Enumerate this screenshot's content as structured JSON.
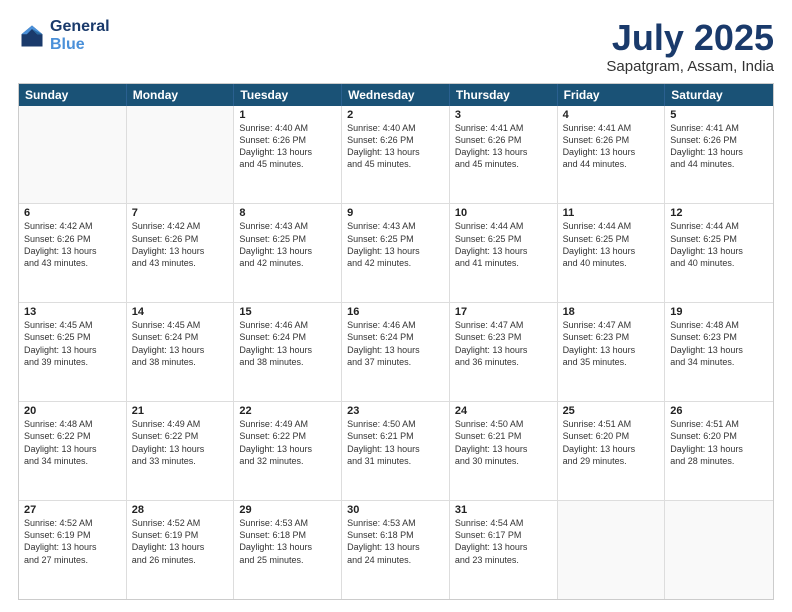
{
  "logo": {
    "line1": "General",
    "line2": "Blue"
  },
  "title": "July 2025",
  "subtitle": "Sapatgram, Assam, India",
  "header_days": [
    "Sunday",
    "Monday",
    "Tuesday",
    "Wednesday",
    "Thursday",
    "Friday",
    "Saturday"
  ],
  "rows": [
    [
      {
        "day": "",
        "lines": [],
        "empty": true
      },
      {
        "day": "",
        "lines": [],
        "empty": true
      },
      {
        "day": "1",
        "lines": [
          "Sunrise: 4:40 AM",
          "Sunset: 6:26 PM",
          "Daylight: 13 hours",
          "and 45 minutes."
        ],
        "empty": false
      },
      {
        "day": "2",
        "lines": [
          "Sunrise: 4:40 AM",
          "Sunset: 6:26 PM",
          "Daylight: 13 hours",
          "and 45 minutes."
        ],
        "empty": false
      },
      {
        "day": "3",
        "lines": [
          "Sunrise: 4:41 AM",
          "Sunset: 6:26 PM",
          "Daylight: 13 hours",
          "and 45 minutes."
        ],
        "empty": false
      },
      {
        "day": "4",
        "lines": [
          "Sunrise: 4:41 AM",
          "Sunset: 6:26 PM",
          "Daylight: 13 hours",
          "and 44 minutes."
        ],
        "empty": false
      },
      {
        "day": "5",
        "lines": [
          "Sunrise: 4:41 AM",
          "Sunset: 6:26 PM",
          "Daylight: 13 hours",
          "and 44 minutes."
        ],
        "empty": false
      }
    ],
    [
      {
        "day": "6",
        "lines": [
          "Sunrise: 4:42 AM",
          "Sunset: 6:26 PM",
          "Daylight: 13 hours",
          "and 43 minutes."
        ],
        "empty": false
      },
      {
        "day": "7",
        "lines": [
          "Sunrise: 4:42 AM",
          "Sunset: 6:26 PM",
          "Daylight: 13 hours",
          "and 43 minutes."
        ],
        "empty": false
      },
      {
        "day": "8",
        "lines": [
          "Sunrise: 4:43 AM",
          "Sunset: 6:25 PM",
          "Daylight: 13 hours",
          "and 42 minutes."
        ],
        "empty": false
      },
      {
        "day": "9",
        "lines": [
          "Sunrise: 4:43 AM",
          "Sunset: 6:25 PM",
          "Daylight: 13 hours",
          "and 42 minutes."
        ],
        "empty": false
      },
      {
        "day": "10",
        "lines": [
          "Sunrise: 4:44 AM",
          "Sunset: 6:25 PM",
          "Daylight: 13 hours",
          "and 41 minutes."
        ],
        "empty": false
      },
      {
        "day": "11",
        "lines": [
          "Sunrise: 4:44 AM",
          "Sunset: 6:25 PM",
          "Daylight: 13 hours",
          "and 40 minutes."
        ],
        "empty": false
      },
      {
        "day": "12",
        "lines": [
          "Sunrise: 4:44 AM",
          "Sunset: 6:25 PM",
          "Daylight: 13 hours",
          "and 40 minutes."
        ],
        "empty": false
      }
    ],
    [
      {
        "day": "13",
        "lines": [
          "Sunrise: 4:45 AM",
          "Sunset: 6:25 PM",
          "Daylight: 13 hours",
          "and 39 minutes."
        ],
        "empty": false
      },
      {
        "day": "14",
        "lines": [
          "Sunrise: 4:45 AM",
          "Sunset: 6:24 PM",
          "Daylight: 13 hours",
          "and 38 minutes."
        ],
        "empty": false
      },
      {
        "day": "15",
        "lines": [
          "Sunrise: 4:46 AM",
          "Sunset: 6:24 PM",
          "Daylight: 13 hours",
          "and 38 minutes."
        ],
        "empty": false
      },
      {
        "day": "16",
        "lines": [
          "Sunrise: 4:46 AM",
          "Sunset: 6:24 PM",
          "Daylight: 13 hours",
          "and 37 minutes."
        ],
        "empty": false
      },
      {
        "day": "17",
        "lines": [
          "Sunrise: 4:47 AM",
          "Sunset: 6:23 PM",
          "Daylight: 13 hours",
          "and 36 minutes."
        ],
        "empty": false
      },
      {
        "day": "18",
        "lines": [
          "Sunrise: 4:47 AM",
          "Sunset: 6:23 PM",
          "Daylight: 13 hours",
          "and 35 minutes."
        ],
        "empty": false
      },
      {
        "day": "19",
        "lines": [
          "Sunrise: 4:48 AM",
          "Sunset: 6:23 PM",
          "Daylight: 13 hours",
          "and 34 minutes."
        ],
        "empty": false
      }
    ],
    [
      {
        "day": "20",
        "lines": [
          "Sunrise: 4:48 AM",
          "Sunset: 6:22 PM",
          "Daylight: 13 hours",
          "and 34 minutes."
        ],
        "empty": false
      },
      {
        "day": "21",
        "lines": [
          "Sunrise: 4:49 AM",
          "Sunset: 6:22 PM",
          "Daylight: 13 hours",
          "and 33 minutes."
        ],
        "empty": false
      },
      {
        "day": "22",
        "lines": [
          "Sunrise: 4:49 AM",
          "Sunset: 6:22 PM",
          "Daylight: 13 hours",
          "and 32 minutes."
        ],
        "empty": false
      },
      {
        "day": "23",
        "lines": [
          "Sunrise: 4:50 AM",
          "Sunset: 6:21 PM",
          "Daylight: 13 hours",
          "and 31 minutes."
        ],
        "empty": false
      },
      {
        "day": "24",
        "lines": [
          "Sunrise: 4:50 AM",
          "Sunset: 6:21 PM",
          "Daylight: 13 hours",
          "and 30 minutes."
        ],
        "empty": false
      },
      {
        "day": "25",
        "lines": [
          "Sunrise: 4:51 AM",
          "Sunset: 6:20 PM",
          "Daylight: 13 hours",
          "and 29 minutes."
        ],
        "empty": false
      },
      {
        "day": "26",
        "lines": [
          "Sunrise: 4:51 AM",
          "Sunset: 6:20 PM",
          "Daylight: 13 hours",
          "and 28 minutes."
        ],
        "empty": false
      }
    ],
    [
      {
        "day": "27",
        "lines": [
          "Sunrise: 4:52 AM",
          "Sunset: 6:19 PM",
          "Daylight: 13 hours",
          "and 27 minutes."
        ],
        "empty": false
      },
      {
        "day": "28",
        "lines": [
          "Sunrise: 4:52 AM",
          "Sunset: 6:19 PM",
          "Daylight: 13 hours",
          "and 26 minutes."
        ],
        "empty": false
      },
      {
        "day": "29",
        "lines": [
          "Sunrise: 4:53 AM",
          "Sunset: 6:18 PM",
          "Daylight: 13 hours",
          "and 25 minutes."
        ],
        "empty": false
      },
      {
        "day": "30",
        "lines": [
          "Sunrise: 4:53 AM",
          "Sunset: 6:18 PM",
          "Daylight: 13 hours",
          "and 24 minutes."
        ],
        "empty": false
      },
      {
        "day": "31",
        "lines": [
          "Sunrise: 4:54 AM",
          "Sunset: 6:17 PM",
          "Daylight: 13 hours",
          "and 23 minutes."
        ],
        "empty": false
      },
      {
        "day": "",
        "lines": [],
        "empty": true
      },
      {
        "day": "",
        "lines": [],
        "empty": true
      }
    ]
  ]
}
